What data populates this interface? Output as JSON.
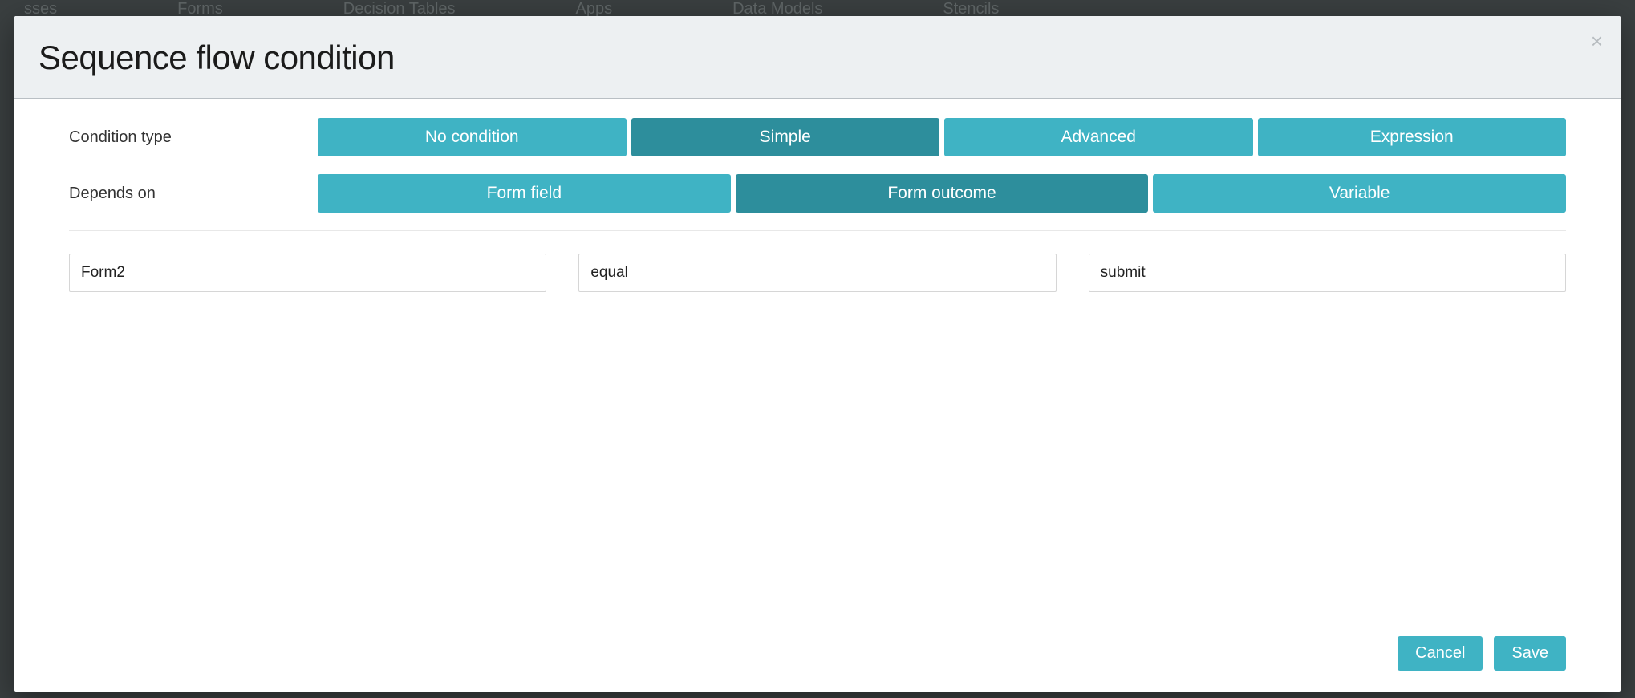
{
  "background_nav": [
    "sses",
    "Forms",
    "Decision Tables",
    "Apps",
    "Data Models",
    "Stencils"
  ],
  "modal": {
    "title": "Sequence flow condition",
    "close_glyph": "×",
    "rows": {
      "condition_type": {
        "label": "Condition type",
        "options": [
          "No condition",
          "Simple",
          "Advanced",
          "Expression"
        ],
        "active": "Simple"
      },
      "depends_on": {
        "label": "Depends on",
        "options": [
          "Form field",
          "Form outcome",
          "Variable"
        ],
        "active": "Form outcome"
      }
    },
    "inputs": {
      "form_value": "Form2",
      "operator_value": "equal",
      "outcome_value": "submit"
    },
    "footer": {
      "cancel": "Cancel",
      "save": "Save"
    }
  }
}
